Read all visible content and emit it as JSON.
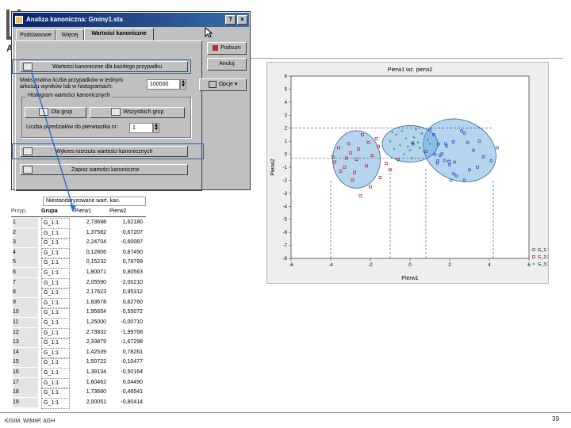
{
  "slide": {
    "footer": "KISIM, WIMiIP, AGH",
    "page_number": "39",
    "partial_title_letter": "A"
  },
  "dialog": {
    "title": "Analiza kanoniczna: Gminy1.sta",
    "tabs": [
      "Podstawowe",
      "Więcej",
      "Wartości kanoniczne"
    ],
    "active_tab": 2,
    "buttons_right": [
      "Podsum",
      "Anuluj",
      "Opcje"
    ],
    "row1_label": "Wartości kanoniczne dla każdego przypadku",
    "maxcases_label": "Maksymalna liczba przypadków w jednym arkuszu wyników lub w histogramach:",
    "maxcases_value": "100000",
    "histogram_group_label": "Histogram wartości kanonicznych",
    "hist_btn_group": "Dla grup",
    "hist_btn_all": "Wszystkich grup",
    "hist_intervals_label": "Liczba przedziałów do pierwiastka nr:",
    "hist_intervals_value": "1",
    "scatter_label": "Wykres rozrzutu wartości kanonicznych",
    "save_label": "Zapisz wartości kanoniczne"
  },
  "plot": {
    "colors": {
      "g1": "#2040c0",
      "g2": "#c02020",
      "g3": "#20a040",
      "ellipse": "#5aa0d8"
    }
  },
  "chart_data": {
    "type": "scatter",
    "title": "Pierw1 wz. pierw2",
    "xlabel": "Pierw1",
    "ylabel": "Pierw2",
    "xlim": [
      -6,
      6
    ],
    "ylim": [
      -8,
      6
    ],
    "xticks": [
      -6,
      -4,
      -2,
      0,
      2,
      4,
      6
    ],
    "yticks": [
      6,
      5,
      4,
      3,
      2,
      1,
      0,
      -1,
      -2,
      -3,
      -4,
      -5,
      -6,
      -7,
      -8
    ],
    "legend": [
      "G_1:1",
      "G_2:2",
      "G_3:3"
    ],
    "legend_position": "right",
    "series": [
      {
        "name": "G_1:1",
        "x": [
          2.74,
          1.38,
          2.25,
          0.13,
          0.15,
          1.8,
          2.06,
          2.18,
          1.84,
          1.96,
          1.25,
          2.74,
          2.34,
          1.43,
          1.51,
          1.39,
          1.61,
          1.74,
          2.0,
          3.5,
          3.2,
          4.1,
          2.6,
          3.0,
          1.0,
          2.9,
          3.7,
          0.8,
          1.2,
          2.2,
          4.4,
          3.4
        ],
        "y": [
          1.62,
          -0.67,
          -0.6,
          0.87,
          0.79,
          0.81,
          -2.0,
          0.95,
          0.63,
          -0.55,
          -0.01,
          -2.0,
          -1.67,
          0.78,
          -0.1,
          -0.5,
          0.04,
          -0.47,
          -0.8,
          1.0,
          0.3,
          -0.5,
          1.8,
          -1.2,
          1.9,
          0.9,
          -0.2,
          0.2,
          1.5,
          -1.5,
          0.5,
          -1.0
        ]
      },
      {
        "name": "G_2:2",
        "x": [
          -3.8,
          -3.2,
          -2.6,
          -3.5,
          -2.2,
          -1.6,
          -3.0,
          -2.9,
          -2.0,
          -1.2,
          -3.6,
          -2.4,
          -1.9,
          -2.8,
          -3.3,
          -1.5,
          -2.7,
          -3.9,
          -2.1,
          -1.0,
          -0.6,
          -3.1,
          -2.5,
          -1.7
        ],
        "y": [
          -0.6,
          -0.3,
          0.4,
          -1.3,
          -0.9,
          0.6,
          0.1,
          -2.0,
          -2.5,
          -0.7,
          0.5,
          1.5,
          -0.1,
          -1.4,
          -1.0,
          -1.8,
          -0.4,
          -0.2,
          0.9,
          -1.2,
          -0.4,
          0.8,
          -3.2,
          1.2
        ]
      },
      {
        "name": "G_3:3",
        "x": [
          -0.7,
          -0.2,
          0.4,
          -0.5,
          0.0,
          0.6,
          -1.0,
          -0.3,
          0.3,
          0.9,
          -0.8,
          0.1,
          0.5,
          -0.4,
          1.0,
          0.2,
          -0.1,
          0.7,
          -0.9,
          -0.6
        ],
        "y": [
          1.5,
          1.2,
          0.9,
          0.7,
          0.3,
          1.6,
          1.0,
          0.0,
          1.9,
          1.1,
          0.4,
          -0.3,
          0.5,
          1.8,
          0.8,
          1.3,
          0.6,
          0.2,
          1.7,
          -0.5
        ]
      }
    ]
  },
  "table": {
    "banner": "Niestandaryzowane wart. kan.",
    "columns": [
      "Przyp.",
      "Grupa",
      "Pierw1",
      "Pierw2"
    ],
    "rows": [
      [
        "1",
        "G_1:1",
        "2,73698",
        "1,62180"
      ],
      [
        "2",
        "G_1:1",
        "1,37582",
        "-0,67207"
      ],
      [
        "3",
        "G_1:1",
        "2,24704",
        "-0,60087"
      ],
      [
        "4",
        "G_1:1",
        "0,12806",
        "0,87490"
      ],
      [
        "5",
        "G_1:1",
        "0,15232",
        "0,78799"
      ],
      [
        "6",
        "G_1:1",
        "1,80071",
        "0,80563"
      ],
      [
        "7",
        "G_1:1",
        "2,05590",
        "-2,00210"
      ],
      [
        "8",
        "G_1:1",
        "2,17623",
        "0,95312"
      ],
      [
        "9",
        "G_1:1",
        "1,83678",
        "0,62760"
      ],
      [
        "10",
        "G_1:1",
        "1,95654",
        "-0,55072"
      ],
      [
        "11",
        "G_1:1",
        "1,25000",
        "-0,00710"
      ],
      [
        "12",
        "G_1:1",
        "2,73832",
        "-1,99768"
      ],
      [
        "13",
        "G_1:1",
        "2,33879",
        "-1,67298"
      ],
      [
        "14",
        "G_1:1",
        "1,42539",
        "0,78261"
      ],
      [
        "15",
        "G_1:1",
        "1,50722",
        "-0,10477"
      ],
      [
        "16",
        "G_1:1",
        "1,39134",
        "-0,50164"
      ],
      [
        "17",
        "G_1:1",
        "1,60462",
        "0,04490"
      ],
      [
        "18",
        "G_1:1",
        "1,73680",
        "-0,46541"
      ],
      [
        "19",
        "G_1:1",
        "2,00051",
        "-0,80414"
      ]
    ]
  }
}
